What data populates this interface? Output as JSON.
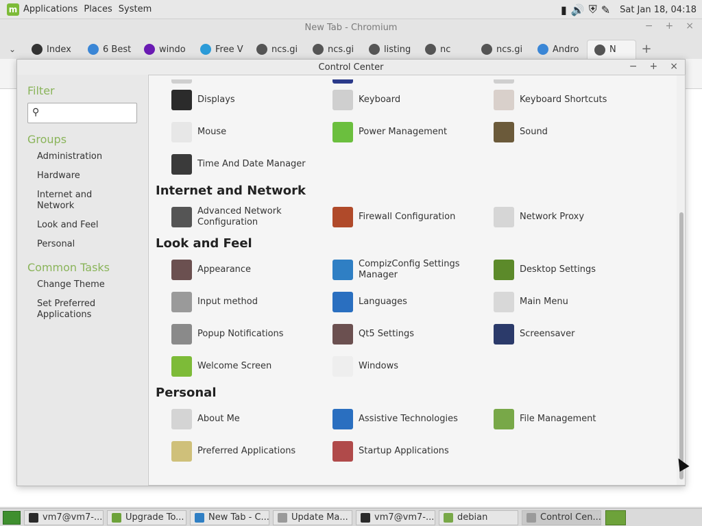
{
  "top_panel": {
    "menus": [
      "Applications",
      "Places",
      "System"
    ],
    "clock": "Sat Jan 18, 04:18"
  },
  "browser": {
    "title": "New Tab - Chromium",
    "tabs": [
      {
        "label": "Index",
        "color": "#333333"
      },
      {
        "label": "6 Best",
        "color": "#3a86d6"
      },
      {
        "label": "windo",
        "color": "#6a1bb3"
      },
      {
        "label": "Free V",
        "color": "#2b9bd8"
      },
      {
        "label": "ncs.gi",
        "color": "#555555"
      },
      {
        "label": "ncs.gi",
        "color": "#555555"
      },
      {
        "label": "listing",
        "color": "#555555"
      },
      {
        "label": "nc",
        "color": "#555555"
      },
      {
        "label": "ncs.gi",
        "color": "#555555"
      },
      {
        "label": "Andro",
        "color": "#3a86d6"
      },
      {
        "label": "N",
        "color": "#555555"
      }
    ]
  },
  "control_center": {
    "title": "Control Center",
    "sidebar": {
      "filter_heading": "Filter",
      "filter_placeholder": "",
      "groups_heading": "Groups",
      "groups": [
        "Administration",
        "Hardware",
        "Internet and Network",
        "Look and Feel",
        "Personal"
      ],
      "tasks_heading": "Common Tasks",
      "tasks": [
        "Change Theme",
        "Set Preferred Applications"
      ]
    },
    "hardware_rows": [
      [
        {
          "label": "Displays",
          "icon": "display-icon",
          "color": "#2b2b2b"
        },
        {
          "label": "Keyboard",
          "icon": "keyboard-icon",
          "color": "#cfcfcf"
        },
        {
          "label": "Keyboard Shortcuts",
          "icon": "keyboard-shortcuts-icon",
          "color": "#d9d0cb"
        }
      ],
      [
        {
          "label": "Mouse",
          "icon": "mouse-icon",
          "color": "#e7e7e7"
        },
        {
          "label": "Power Management",
          "icon": "battery-icon",
          "color": "#6bbf3e"
        },
        {
          "label": "Sound",
          "icon": "speaker-icon",
          "color": "#6b5a3a"
        }
      ],
      [
        {
          "label": "Time And Date Manager",
          "icon": "clock-icon",
          "color": "#3a3a3a"
        }
      ]
    ],
    "categories": [
      {
        "title": "Internet and Network",
        "rows": [
          [
            {
              "label": "Advanced Network Configuration",
              "icon": "network-icon",
              "color": "#555555"
            },
            {
              "label": "Firewall Configuration",
              "icon": "firewall-icon",
              "color": "#b04a2a"
            },
            {
              "label": "Network Proxy",
              "icon": "proxy-icon",
              "color": "#d6d6d6"
            }
          ]
        ]
      },
      {
        "title": "Look and Feel",
        "rows": [
          [
            {
              "label": "Appearance",
              "icon": "appearance-icon",
              "color": "#6b5050"
            },
            {
              "label": "CompizConfig Settings Manager",
              "icon": "compiz-icon",
              "color": "#2f7fc4"
            },
            {
              "label": "Desktop Settings",
              "icon": "desktop-icon",
              "color": "#5c8a2a"
            }
          ],
          [
            {
              "label": "Input method",
              "icon": "input-method-icon",
              "color": "#9a9a9a"
            },
            {
              "label": "Languages",
              "icon": "languages-icon",
              "color": "#2a6fc0"
            },
            {
              "label": "Main Menu",
              "icon": "main-menu-icon",
              "color": "#d8d8d8"
            }
          ],
          [
            {
              "label": "Popup Notifications",
              "icon": "notification-icon",
              "color": "#8a8a8a"
            },
            {
              "label": "Qt5 Settings",
              "icon": "qt5-icon",
              "color": "#6b5050"
            },
            {
              "label": "Screensaver",
              "icon": "screensaver-icon",
              "color": "#2b3a6a"
            }
          ],
          [
            {
              "label": "Welcome Screen",
              "icon": "mint-icon",
              "color": "#7dbb38"
            },
            {
              "label": "Windows",
              "icon": "windows-icon",
              "color": "#eeeeee"
            }
          ]
        ]
      },
      {
        "title": "Personal",
        "rows": [
          [
            {
              "label": "About Me",
              "icon": "about-me-icon",
              "color": "#d4d4d4"
            },
            {
              "label": "Assistive Technologies",
              "icon": "accessibility-icon",
              "color": "#2a6fc0"
            },
            {
              "label": "File Management",
              "icon": "folder-icon",
              "color": "#78a848"
            }
          ],
          [
            {
              "label": "Preferred Applications",
              "icon": "preferred-apps-icon",
              "color": "#cfc07a"
            },
            {
              "label": "Startup Applications",
              "icon": "startup-icon",
              "color": "#b04a4a"
            }
          ]
        ]
      }
    ]
  },
  "taskbar": {
    "tasks": [
      {
        "label": "vm7@vm7-...",
        "color": "#2b2b2b"
      },
      {
        "label": "Upgrade To...",
        "color": "#6da23a"
      },
      {
        "label": "New Tab - C...",
        "color": "#2f7fc4"
      },
      {
        "label": "Update Ma...",
        "color": "#9a9a9a"
      },
      {
        "label": "vm7@vm7-...",
        "color": "#2b2b2b"
      },
      {
        "label": "debian",
        "color": "#78a848"
      },
      {
        "label": "Control Cen...",
        "color": "#9a9a9a"
      }
    ]
  }
}
